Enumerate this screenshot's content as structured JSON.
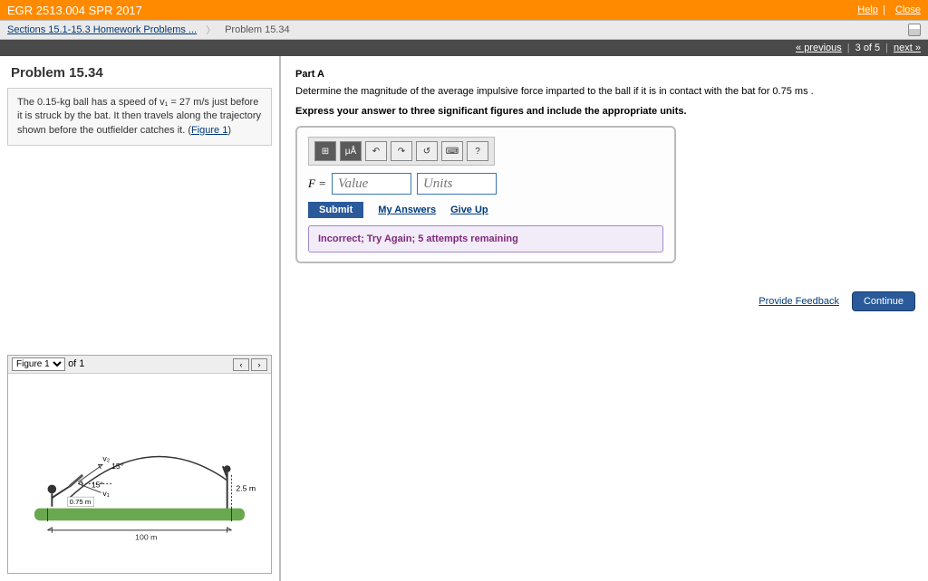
{
  "header": {
    "course_title": "EGR 2513.004 SPR 2017",
    "help": "Help",
    "close": "Close"
  },
  "breadcrumb": {
    "section_link": "Sections 15.1-15.3 Homework Problems ...",
    "current": "Problem 15.34"
  },
  "nav": {
    "prev": "« previous",
    "pos": "3 of 5",
    "next": "next »"
  },
  "left": {
    "problem_title": "Problem 15.34",
    "problem_text_1": "The 0.15-kg ball has a speed of v₁ = 27 m/s just before it is struck by the bat. It then travels along the trajectory shown before the outfielder catches it. (",
    "figure_link": "Figure 1",
    "problem_text_2": ")",
    "figure_selector": "Figure 1",
    "figure_of": "of 1",
    "fig": {
      "v2_label": "v₂",
      "angle_up": "15°",
      "angle_down": "15°",
      "h_batter": "0.75 m",
      "h_catcher": "2.5 m",
      "distance": "100 m",
      "v1_label": "v₁"
    }
  },
  "right": {
    "part_title": "Part A",
    "question": "Determine the magnitude of the average impulsive force imparted to the ball if it is in contact with the bat for 0.75 ms .",
    "instruction": "Express your answer to three significant figures and include the appropriate units.",
    "toolbar": {
      "templates": "⊞",
      "greek": "μÅ",
      "undo": "↶",
      "redo": "↷",
      "reset": "↺",
      "keyboard": "⌨",
      "help": "?"
    },
    "eq_label": "F = ",
    "value_placeholder": "Value",
    "units_placeholder": "Units",
    "submit": "Submit",
    "my_answers": "My Answers",
    "give_up": "Give Up",
    "feedback": "Incorrect; Try Again; 5 attempts remaining",
    "provide_feedback": "Provide Feedback",
    "continue": "Continue"
  }
}
